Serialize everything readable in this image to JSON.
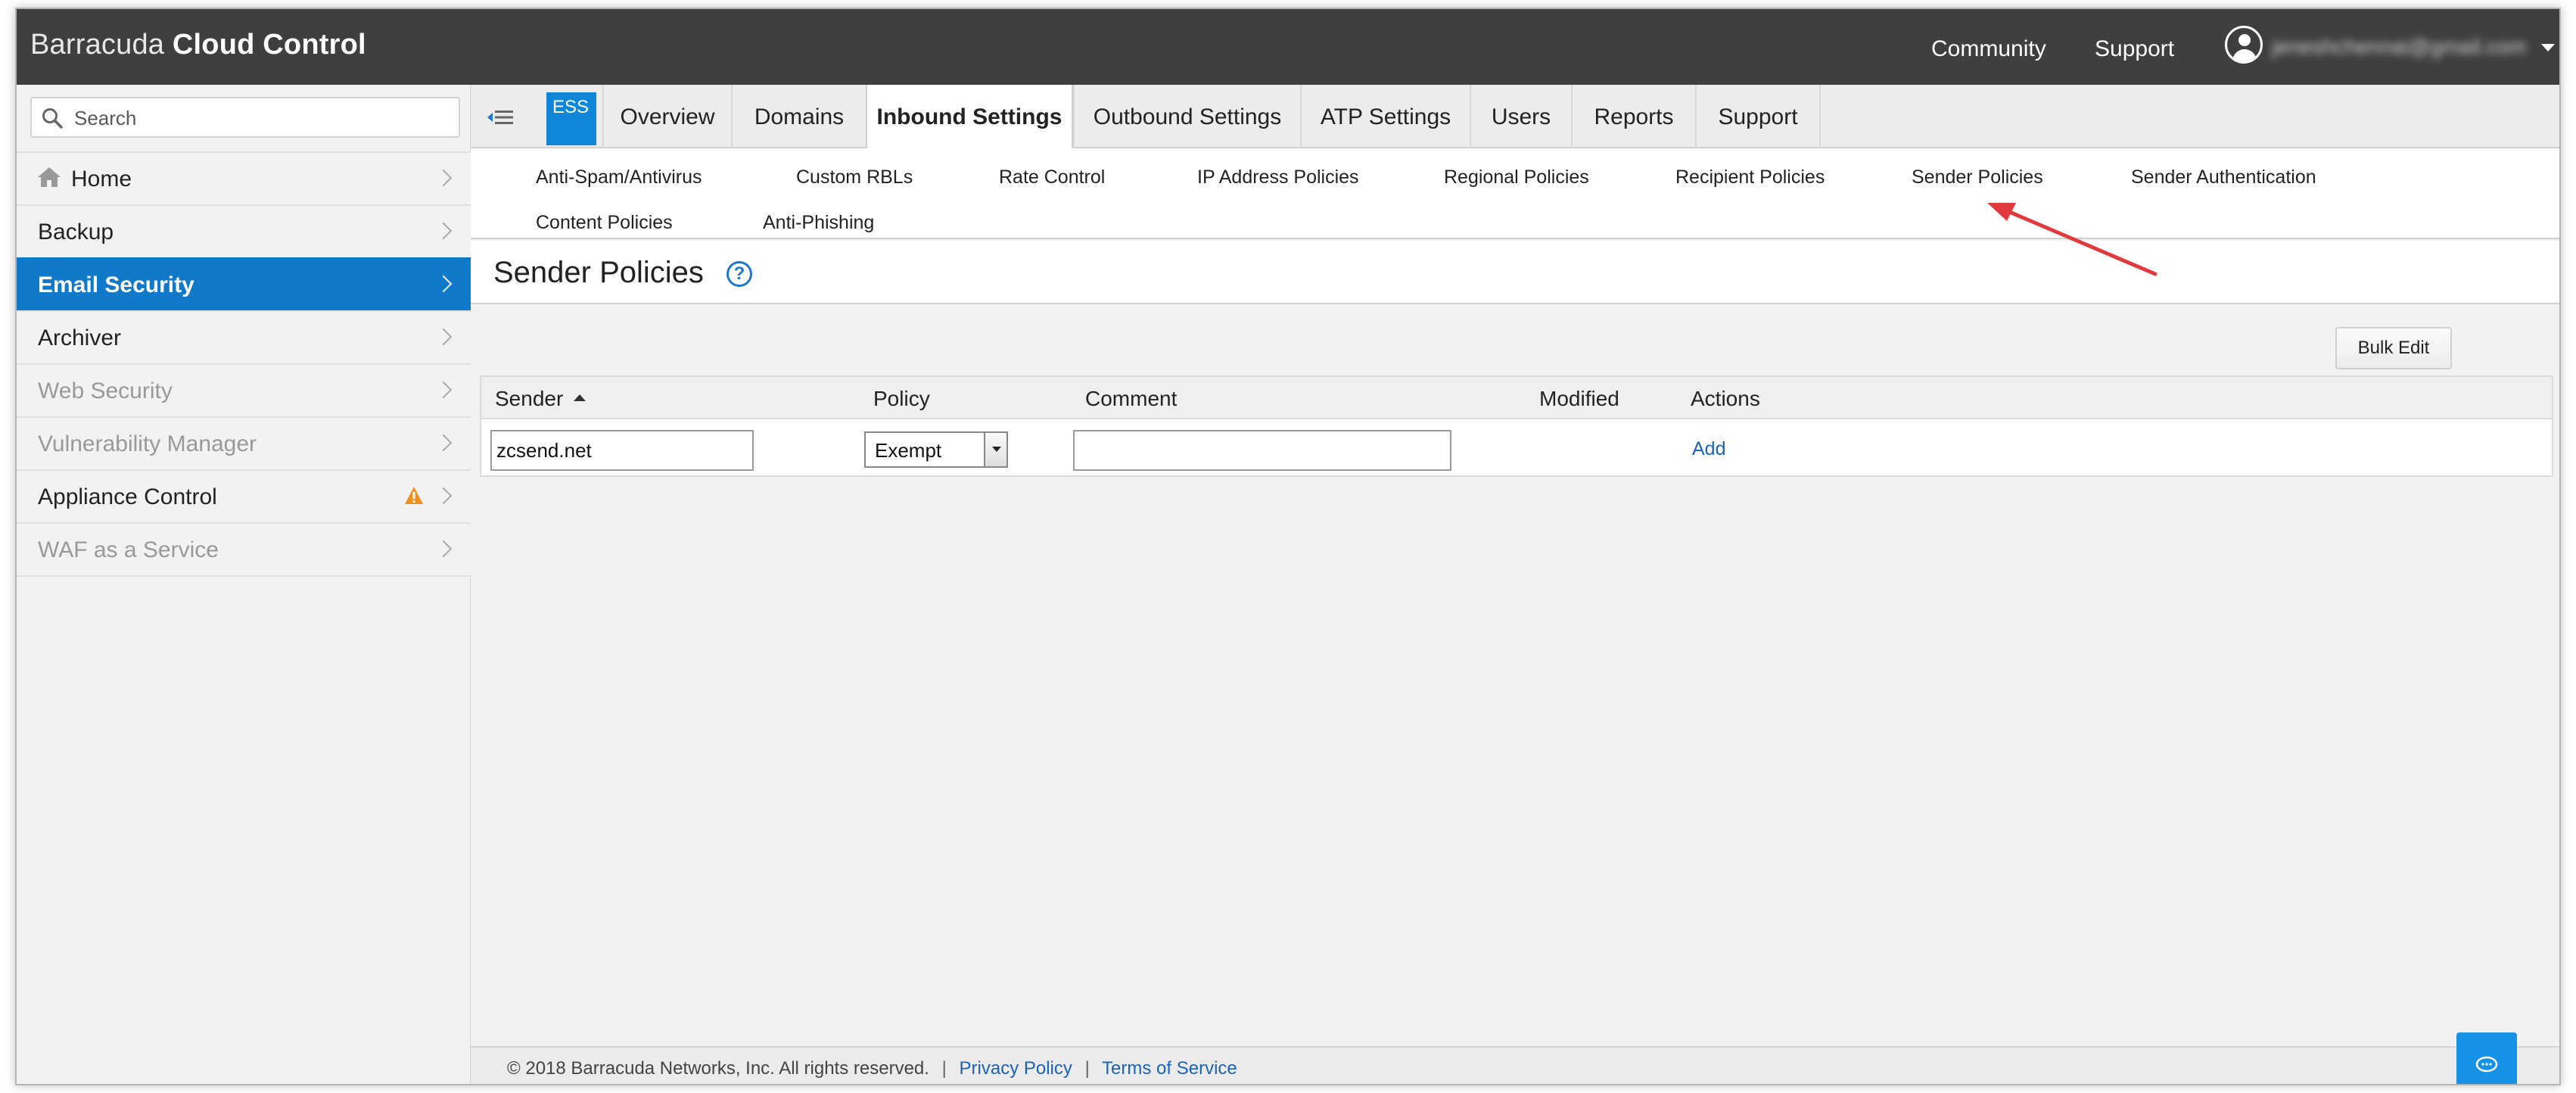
{
  "app": {
    "brand_light": "Barracuda",
    "brand_bold": "Cloud Control"
  },
  "header": {
    "links": [
      "Community",
      "Support"
    ],
    "user_email": "jeneshchennai@gmail.com"
  },
  "sidebar": {
    "search_placeholder": "Search",
    "items": [
      {
        "label": "Home",
        "state": "normal"
      },
      {
        "label": "Backup",
        "state": "normal"
      },
      {
        "label": "Email Security",
        "state": "active"
      },
      {
        "label": "Archiver",
        "state": "normal"
      },
      {
        "label": "Web Security",
        "state": "disabled"
      },
      {
        "label": "Vulnerability Manager",
        "state": "disabled"
      },
      {
        "label": "Appliance Control",
        "state": "warning"
      },
      {
        "label": "WAF as a Service",
        "state": "disabled"
      }
    ]
  },
  "product_badge": "ESS",
  "tabs": [
    "Overview",
    "Domains",
    "Inbound Settings",
    "Outbound Settings",
    "ATP Settings",
    "Users",
    "Reports",
    "Support"
  ],
  "active_tab": "Inbound Settings",
  "subtabs": [
    "Anti-Spam/Antivirus",
    "Custom RBLs",
    "Rate Control",
    "IP Address Policies",
    "Regional Policies",
    "Recipient Policies",
    "Sender Policies",
    "Sender Authentication",
    "Content Policies",
    "Anti-Phishing"
  ],
  "page": {
    "title": "Sender Policies",
    "help": "?",
    "bulk_edit": "Bulk Edit"
  },
  "table": {
    "columns": [
      "Sender",
      "Policy",
      "Comment",
      "Modified",
      "Actions"
    ],
    "sort_column": "Sender",
    "sort_direction": "ascending",
    "new_row": {
      "sender": "zcsend.net",
      "policy": "Exempt",
      "comment": "",
      "action": "Add"
    }
  },
  "footer": {
    "copyright": "© 2018 Barracuda Networks, Inc. All rights reserved.",
    "privacy": "Privacy Policy",
    "terms": "Terms of Service",
    "separator": "|"
  },
  "colors": {
    "header_bg": "#3f3f3f",
    "active_nav": "#1079c9",
    "badge": "#0f86d8",
    "link": "#1a63b5",
    "warning": "#f0901e",
    "annotation_arrow": "#e0393e"
  }
}
